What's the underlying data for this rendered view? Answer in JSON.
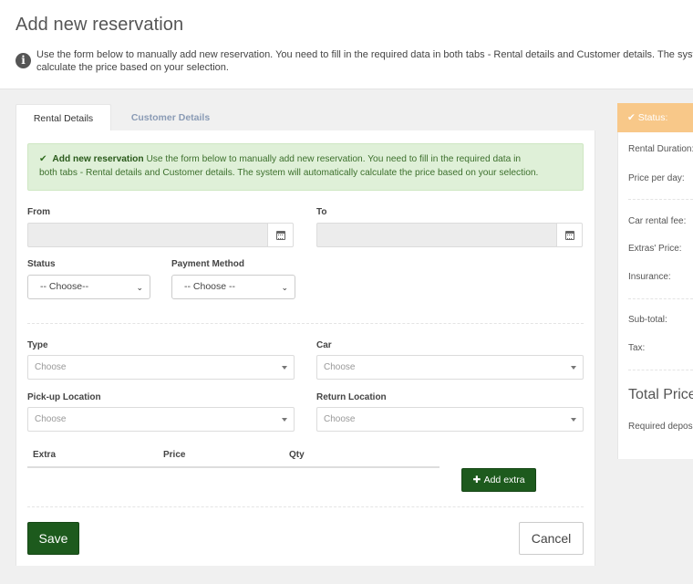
{
  "header": {
    "title": "Add new reservation",
    "intro_line1": "Use the form below to manually add new reservation. You need to fill in the required data in both tabs - Rental details and Customer details. The system will automatically",
    "intro_line2": "calculate the price based on your selection."
  },
  "tabs": [
    {
      "label": "Rental Details",
      "active": true
    },
    {
      "label": "Customer Details",
      "active": false
    }
  ],
  "alert": {
    "title": "Add new reservation",
    "line1": "Use the form below to manually add new reservation. You need to fill in the required data in",
    "line2": "both tabs - Rental details and Customer details. The system will automatically calculate the price based on your selection."
  },
  "form": {
    "from_label": "From",
    "to_label": "To",
    "status_label": "Status",
    "status_value": "-- Choose--",
    "payment_label": "Payment Method",
    "payment_value": "-- Choose --",
    "type_label": "Type",
    "type_placeholder": "Choose",
    "car_label": "Car",
    "car_placeholder": "Choose",
    "pickup_label": "Pick-up Location",
    "pickup_placeholder": "Choose",
    "return_label": "Return Location",
    "return_placeholder": "Choose"
  },
  "extras": {
    "columns": [
      "Extra",
      "Price",
      "Qty"
    ],
    "add_label": "Add extra"
  },
  "actions": {
    "save_label": "Save",
    "cancel_label": "Cancel"
  },
  "sidebar": {
    "status_label": "Status:",
    "rental_duration": "Rental Duration:",
    "price_per_day": "Price per day:",
    "car_rental_fee": "Car rental fee:",
    "extras_price": "Extras' Price:",
    "insurance": "Insurance:",
    "sub_total": "Sub-total:",
    "tax": "Tax:",
    "total_price": "Total Price",
    "required_deposit": "Required deposit:"
  },
  "colors": {
    "primary_button": "#1d5a1d",
    "alert_bg": "#dff0d8",
    "status_orange": "#f8c889"
  }
}
